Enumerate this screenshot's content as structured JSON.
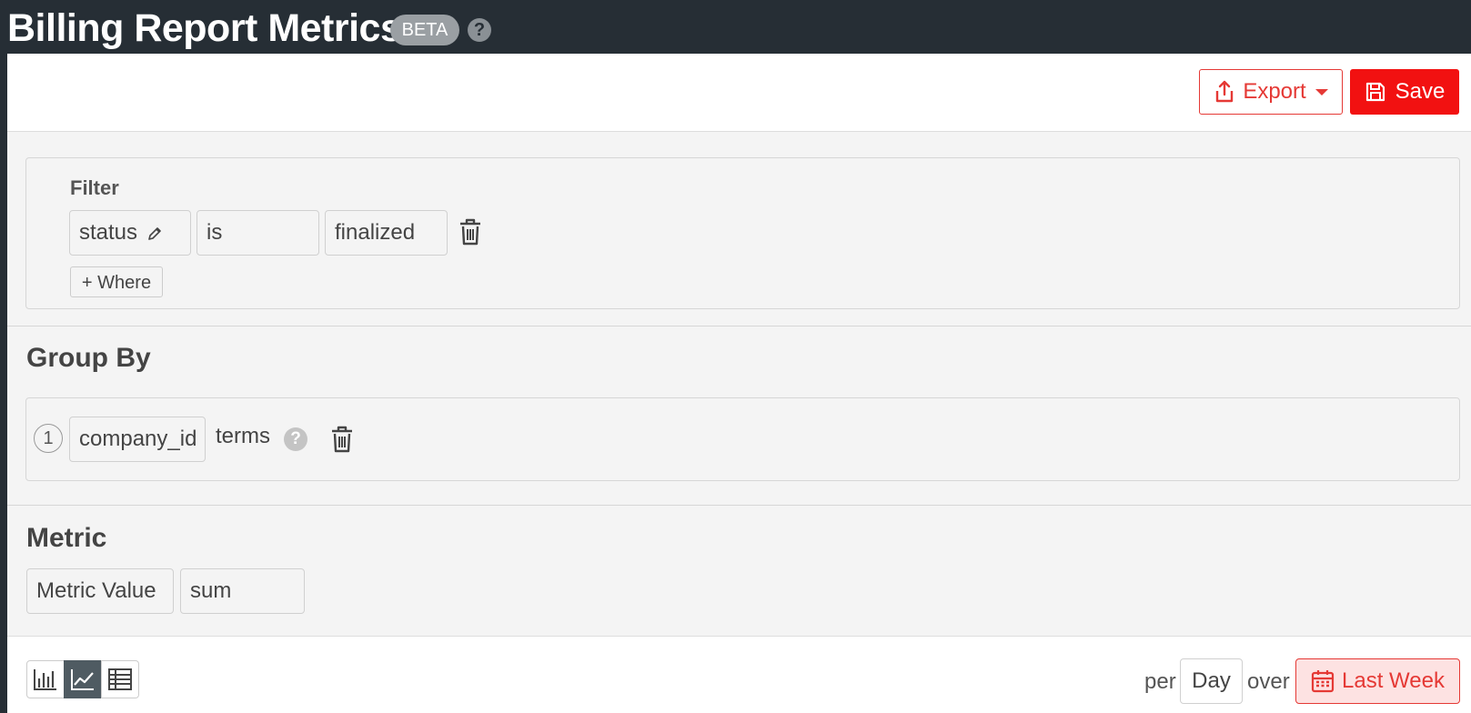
{
  "header": {
    "title": "Billing Report Metrics",
    "badge": "BETA",
    "help_glyph": "?"
  },
  "toolbar": {
    "export_label": "Export",
    "save_label": "Save"
  },
  "filter": {
    "label": "Filter",
    "conditions": [
      {
        "field": "status",
        "operator": "is",
        "value": "finalized"
      }
    ],
    "add_where_label": "+ Where"
  },
  "group_by": {
    "title": "Group By",
    "items": [
      {
        "order": "1",
        "field": "company_id",
        "type": "terms"
      }
    ]
  },
  "metric": {
    "title": "Metric",
    "field": "Metric Value",
    "aggregation": "sum"
  },
  "footer": {
    "per_label": "per",
    "interval": "Day",
    "over_label": "over",
    "range_label": "Last Week",
    "view_modes": [
      "bar-chart",
      "line-chart",
      "table"
    ],
    "active_view": "line-chart"
  },
  "colors": {
    "accent": "#f21111",
    "header_bg": "#262e35",
    "panel_bg": "#f4f4f4"
  }
}
